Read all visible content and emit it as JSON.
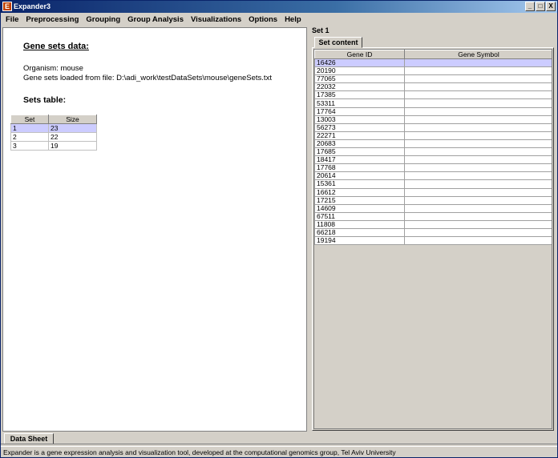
{
  "window": {
    "title": "Expander3",
    "icon_letter": "E",
    "controls": [
      "_",
      "□",
      "X"
    ]
  },
  "menu": [
    "File",
    "Preprocessing",
    "Grouping",
    "Group Analysis",
    "Visualizations",
    "Options",
    "Help"
  ],
  "left": {
    "heading": "Gene sets data:",
    "organism": "Organism: mouse",
    "loaded_from": "Gene sets loaded from file: D:\\adi_work\\testDataSets\\mouse\\geneSets.txt",
    "sets_heading": "Sets table:",
    "sets_table": {
      "columns": [
        "Set",
        "Size"
      ],
      "rows": [
        [
          "1",
          "23"
        ],
        [
          "2",
          "22"
        ],
        [
          "3",
          "19"
        ]
      ],
      "selected_row": 0
    }
  },
  "right": {
    "title": "Set 1",
    "tab": "Set content",
    "gene_table": {
      "columns": [
        "Gene ID",
        "Gene Symbol"
      ],
      "rows": [
        "16426",
        "20190",
        "77065",
        "22032",
        "17385",
        "53311",
        "17764",
        "13003",
        "56273",
        "22271",
        "20683",
        "17685",
        "18417",
        "17768",
        "20614",
        "15361",
        "16612",
        "17215",
        "14609",
        "67511",
        "11808",
        "66218",
        "19194"
      ],
      "selected_row": 0
    }
  },
  "bottom_tab": "Data Sheet",
  "status": "Expander is a gene expression analysis and visualization tool, developed at the computational genomics group, Tel Aviv University",
  "colors": {
    "titlebar": "#0a246a",
    "selection": "#ccccff",
    "chrome": "#d4d0c8"
  }
}
